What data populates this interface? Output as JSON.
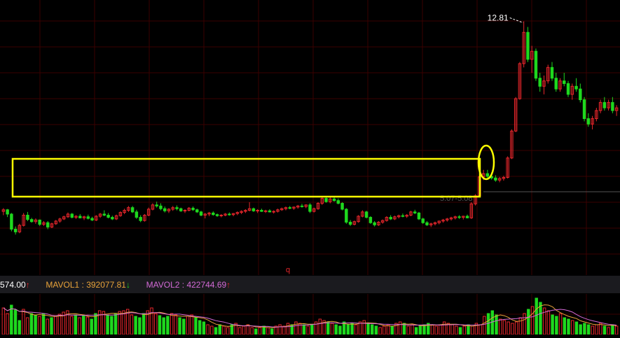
{
  "colors": {
    "background": "#000000",
    "grid": "#2a0000",
    "up": "#e8262b",
    "down": "#1ed81e",
    "annotation": "#ffff00",
    "label_text": "#ffffff",
    "mavol1": "#e8a33a",
    "mavol2": "#d36ad6",
    "vol_bar_bg": "#1b1b1f"
  },
  "chart_data": {
    "type": "candlestick",
    "y_scale": "price",
    "grid": true,
    "max_label": "12.81",
    "range_label": "5.07-5.08",
    "q_marker": "q",
    "annotations": [
      {
        "shape": "rectangle",
        "description_text": ""
      },
      {
        "shape": "ellipse",
        "description_text": ""
      }
    ],
    "candles": [
      [
        5.76,
        5.88,
        5.62,
        5.82
      ],
      [
        5.82,
        5.85,
        5.55,
        5.66
      ],
      [
        5.66,
        5.7,
        5.02,
        5.1
      ],
      [
        5.1,
        5.2,
        4.9,
        5.0
      ],
      [
        5.0,
        5.3,
        4.95,
        5.24
      ],
      [
        5.24,
        5.7,
        5.2,
        5.62
      ],
      [
        5.62,
        5.74,
        5.4,
        5.46
      ],
      [
        5.46,
        5.52,
        5.34,
        5.38
      ],
      [
        5.38,
        5.5,
        5.3,
        5.44
      ],
      [
        5.44,
        5.46,
        5.22,
        5.28
      ],
      [
        5.28,
        5.4,
        5.22,
        5.34
      ],
      [
        5.34,
        5.4,
        5.1,
        5.18
      ],
      [
        5.18,
        5.34,
        5.14,
        5.3
      ],
      [
        5.3,
        5.44,
        5.26,
        5.4
      ],
      [
        5.4,
        5.52,
        5.34,
        5.48
      ],
      [
        5.48,
        5.6,
        5.44,
        5.56
      ],
      [
        5.56,
        5.72,
        5.52,
        5.66
      ],
      [
        5.66,
        5.7,
        5.5,
        5.54
      ],
      [
        5.54,
        5.62,
        5.48,
        5.58
      ],
      [
        5.58,
        5.66,
        5.5,
        5.52
      ],
      [
        5.52,
        5.6,
        5.44,
        5.56
      ],
      [
        5.56,
        5.64,
        5.46,
        5.5
      ],
      [
        5.5,
        5.56,
        5.4,
        5.44
      ],
      [
        5.44,
        5.62,
        5.4,
        5.58
      ],
      [
        5.58,
        5.7,
        5.52,
        5.66
      ],
      [
        5.66,
        5.8,
        5.58,
        5.62
      ],
      [
        5.62,
        5.7,
        5.5,
        5.54
      ],
      [
        5.54,
        5.6,
        5.44,
        5.48
      ],
      [
        5.48,
        5.64,
        5.44,
        5.6
      ],
      [
        5.6,
        5.76,
        5.56,
        5.72
      ],
      [
        5.72,
        5.86,
        5.66,
        5.8
      ],
      [
        5.8,
        5.96,
        5.74,
        5.9
      ],
      [
        5.9,
        5.96,
        5.7,
        5.74
      ],
      [
        5.74,
        5.82,
        5.48,
        5.54
      ],
      [
        5.54,
        5.62,
        5.36,
        5.42
      ],
      [
        5.42,
        5.66,
        5.38,
        5.62
      ],
      [
        5.62,
        5.9,
        5.58,
        5.84
      ],
      [
        5.84,
        6.06,
        5.8,
        6.0
      ],
      [
        6.0,
        6.12,
        5.9,
        5.96
      ],
      [
        5.96,
        6.06,
        5.8,
        5.86
      ],
      [
        5.86,
        5.94,
        5.72,
        5.78
      ],
      [
        5.78,
        5.88,
        5.7,
        5.84
      ],
      [
        5.84,
        5.96,
        5.78,
        5.9
      ],
      [
        5.9,
        5.98,
        5.8,
        5.86
      ],
      [
        5.86,
        5.9,
        5.74,
        5.78
      ],
      [
        5.78,
        5.84,
        5.7,
        5.8
      ],
      [
        5.8,
        5.92,
        5.76,
        5.88
      ],
      [
        5.88,
        5.94,
        5.78,
        5.82
      ],
      [
        5.82,
        5.86,
        5.7,
        5.74
      ],
      [
        5.74,
        5.78,
        5.58,
        5.62
      ],
      [
        5.62,
        5.7,
        5.5,
        5.66
      ],
      [
        5.66,
        5.74,
        5.58,
        5.7
      ],
      [
        5.7,
        5.76,
        5.6,
        5.64
      ],
      [
        5.64,
        5.68,
        5.56,
        5.6
      ],
      [
        5.6,
        5.66,
        5.54,
        5.62
      ],
      [
        5.62,
        5.7,
        5.58,
        5.66
      ],
      [
        5.66,
        5.72,
        5.6,
        5.64
      ],
      [
        5.64,
        5.7,
        5.58,
        5.68
      ],
      [
        5.68,
        5.76,
        5.62,
        5.72
      ],
      [
        5.72,
        5.8,
        5.66,
        5.76
      ],
      [
        5.76,
        5.84,
        5.7,
        5.8
      ],
      [
        5.8,
        6.1,
        5.76,
        5.86
      ],
      [
        5.86,
        5.9,
        5.74,
        5.78
      ],
      [
        5.78,
        5.84,
        5.7,
        5.8
      ],
      [
        5.8,
        5.86,
        5.74,
        5.76
      ],
      [
        5.76,
        5.82,
        5.7,
        5.78
      ],
      [
        5.78,
        5.84,
        5.72,
        5.74
      ],
      [
        5.74,
        5.8,
        5.68,
        5.76
      ],
      [
        5.76,
        5.86,
        5.72,
        5.82
      ],
      [
        5.82,
        5.9,
        5.78,
        5.86
      ],
      [
        5.86,
        5.94,
        5.8,
        5.9
      ],
      [
        5.9,
        5.96,
        5.84,
        5.88
      ],
      [
        5.88,
        5.94,
        5.82,
        5.92
      ],
      [
        5.92,
        6.0,
        5.86,
        5.96
      ],
      [
        5.96,
        6.04,
        5.9,
        5.94
      ],
      [
        5.94,
        6.02,
        5.88,
        6.0
      ],
      [
        6.0,
        6.06,
        5.7,
        5.76
      ],
      [
        5.76,
        5.9,
        5.72,
        5.86
      ],
      [
        5.86,
        6.1,
        5.82,
        6.06
      ],
      [
        6.06,
        6.3,
        6.0,
        6.24
      ],
      [
        6.24,
        6.3,
        6.08,
        6.12
      ],
      [
        6.12,
        6.28,
        6.06,
        6.22
      ],
      [
        6.22,
        6.28,
        6.12,
        6.16
      ],
      [
        6.16,
        6.24,
        6.02,
        6.06
      ],
      [
        6.06,
        6.1,
        5.8,
        5.84
      ],
      [
        5.84,
        5.88,
        5.3,
        5.36
      ],
      [
        5.36,
        5.44,
        5.22,
        5.28
      ],
      [
        5.28,
        5.42,
        5.24,
        5.38
      ],
      [
        5.38,
        5.62,
        5.34,
        5.58
      ],
      [
        5.58,
        5.8,
        5.54,
        5.74
      ],
      [
        5.74,
        5.78,
        5.5,
        5.54
      ],
      [
        5.54,
        5.58,
        5.3,
        5.34
      ],
      [
        5.34,
        5.4,
        5.2,
        5.26
      ],
      [
        5.26,
        5.4,
        5.22,
        5.36
      ],
      [
        5.36,
        5.46,
        5.3,
        5.42
      ],
      [
        5.42,
        5.58,
        5.38,
        5.54
      ],
      [
        5.54,
        5.62,
        5.44,
        5.48
      ],
      [
        5.48,
        5.6,
        5.44,
        5.56
      ],
      [
        5.56,
        5.64,
        5.5,
        5.6
      ],
      [
        5.6,
        5.68,
        5.54,
        5.58
      ],
      [
        5.58,
        5.66,
        5.52,
        5.62
      ],
      [
        5.62,
        5.78,
        5.58,
        5.74
      ],
      [
        5.74,
        5.82,
        5.66,
        5.7
      ],
      [
        5.7,
        5.74,
        5.44,
        5.48
      ],
      [
        5.48,
        5.52,
        5.3,
        5.34
      ],
      [
        5.34,
        5.4,
        5.22,
        5.26
      ],
      [
        5.26,
        5.34,
        5.18,
        5.3
      ],
      [
        5.3,
        5.38,
        5.24,
        5.34
      ],
      [
        5.34,
        5.42,
        5.28,
        5.4
      ],
      [
        5.4,
        5.48,
        5.34,
        5.44
      ],
      [
        5.44,
        5.52,
        5.38,
        5.48
      ],
      [
        5.48,
        5.56,
        5.42,
        5.52
      ],
      [
        5.52,
        5.6,
        5.46,
        5.56
      ],
      [
        5.56,
        5.62,
        5.48,
        5.54
      ],
      [
        5.54,
        5.6,
        5.46,
        5.58
      ],
      [
        5.58,
        5.64,
        5.5,
        5.52
      ],
      [
        5.52,
        6.1,
        5.48,
        6.04
      ],
      [
        6.04,
        6.4,
        5.98,
        6.34
      ],
      [
        6.34,
        7.1,
        6.3,
        7.04
      ],
      [
        7.04,
        7.3,
        6.92,
        7.16
      ],
      [
        7.16,
        7.3,
        7.0,
        7.06
      ],
      [
        7.06,
        7.2,
        6.94,
        7.0
      ],
      [
        7.0,
        7.1,
        6.86,
        6.92
      ],
      [
        6.92,
        7.04,
        6.84,
        6.98
      ],
      [
        6.98,
        7.08,
        6.9,
        7.02
      ],
      [
        7.02,
        7.8,
        6.98,
        7.74
      ],
      [
        7.74,
        8.8,
        7.7,
        8.74
      ],
      [
        8.74,
        10.0,
        8.7,
        9.94
      ],
      [
        9.94,
        11.3,
        9.9,
        11.24
      ],
      [
        11.24,
        12.81,
        11.1,
        12.4
      ],
      [
        12.4,
        12.6,
        11.3,
        11.4
      ],
      [
        11.4,
        11.9,
        10.9,
        11.7
      ],
      [
        11.7,
        11.8,
        10.6,
        10.7
      ],
      [
        10.7,
        10.9,
        10.2,
        10.4
      ],
      [
        10.4,
        10.8,
        10.1,
        10.6
      ],
      [
        10.6,
        11.2,
        10.5,
        11.1
      ],
      [
        11.1,
        11.3,
        10.6,
        10.7
      ],
      [
        10.7,
        10.9,
        10.2,
        10.3
      ],
      [
        10.3,
        10.7,
        10.2,
        10.6
      ],
      [
        10.6,
        10.9,
        10.4,
        10.5
      ],
      [
        10.5,
        10.6,
        10.0,
        10.1
      ],
      [
        10.1,
        10.5,
        9.9,
        10.4
      ],
      [
        10.4,
        10.7,
        10.2,
        10.3
      ],
      [
        10.3,
        10.5,
        9.8,
        9.9
      ],
      [
        9.9,
        10.0,
        9.1,
        9.2
      ],
      [
        9.2,
        9.4,
        8.9,
        9.0
      ],
      [
        9.0,
        9.3,
        8.8,
        9.2
      ],
      [
        9.2,
        9.6,
        9.1,
        9.5
      ],
      [
        9.5,
        9.9,
        9.4,
        9.8
      ],
      [
        9.8,
        10.0,
        9.5,
        9.6
      ],
      [
        9.6,
        9.9,
        9.5,
        9.8
      ],
      [
        9.8,
        10.0,
        9.4,
        9.5
      ],
      [
        9.5,
        9.7,
        9.3,
        9.6
      ]
    ],
    "volume_indicator": {
      "vol_value": "574.00",
      "vol_arrow": "↑",
      "mavol1_label": "MAVOL1",
      "mavol1_value": "392077.81",
      "mavol1_arrow": "↓",
      "mavol2_label": "MAVOL2",
      "mavol2_value": "422744.69",
      "mavol2_arrow": "↑"
    },
    "volume": [
      38,
      30,
      42,
      35,
      20,
      36,
      24,
      30,
      28,
      26,
      30,
      22,
      24,
      27,
      29,
      32,
      34,
      26,
      28,
      24,
      28,
      25,
      22,
      30,
      34,
      33,
      28,
      26,
      30,
      33,
      34,
      36,
      28,
      26,
      24,
      30,
      34,
      38,
      30,
      27,
      24,
      26,
      30,
      28,
      24,
      22,
      26,
      28,
      24,
      20,
      18,
      14,
      12,
      10,
      14,
      12,
      10,
      14,
      16,
      10,
      12,
      14,
      10,
      8,
      10,
      12,
      10,
      8,
      12,
      14,
      12,
      16,
      14,
      18,
      16,
      14,
      12,
      14,
      18,
      22,
      20,
      18,
      16,
      14,
      12,
      18,
      14,
      16,
      14,
      18,
      20,
      16,
      14,
      12,
      10,
      12,
      14,
      12,
      16,
      18,
      16,
      12,
      14,
      10,
      12,
      14,
      16,
      14,
      12,
      14,
      18,
      16,
      14,
      12,
      10,
      12,
      14,
      12,
      16,
      14,
      26,
      30,
      34,
      28,
      22,
      20,
      18,
      16,
      18,
      24,
      30,
      36,
      40,
      52,
      46,
      38,
      34,
      28,
      26,
      30,
      24,
      22,
      20,
      18,
      14,
      16,
      14,
      12,
      14,
      16,
      12,
      10,
      14,
      12
    ]
  }
}
